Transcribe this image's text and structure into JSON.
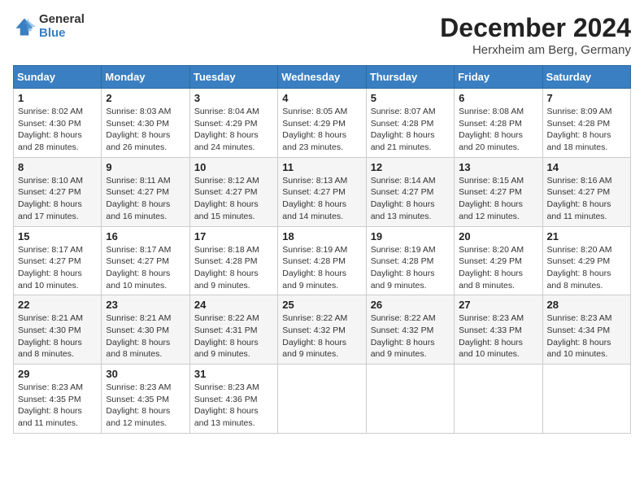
{
  "header": {
    "logo_line1": "General",
    "logo_line2": "Blue",
    "month": "December 2024",
    "location": "Herxheim am Berg, Germany"
  },
  "days_of_week": [
    "Sunday",
    "Monday",
    "Tuesday",
    "Wednesday",
    "Thursday",
    "Friday",
    "Saturday"
  ],
  "weeks": [
    [
      {
        "day": 1,
        "sunrise": "8:02 AM",
        "sunset": "4:30 PM",
        "daylight": "8 hours and 28 minutes."
      },
      {
        "day": 2,
        "sunrise": "8:03 AM",
        "sunset": "4:30 PM",
        "daylight": "8 hours and 26 minutes."
      },
      {
        "day": 3,
        "sunrise": "8:04 AM",
        "sunset": "4:29 PM",
        "daylight": "8 hours and 24 minutes."
      },
      {
        "day": 4,
        "sunrise": "8:05 AM",
        "sunset": "4:29 PM",
        "daylight": "8 hours and 23 minutes."
      },
      {
        "day": 5,
        "sunrise": "8:07 AM",
        "sunset": "4:28 PM",
        "daylight": "8 hours and 21 minutes."
      },
      {
        "day": 6,
        "sunrise": "8:08 AM",
        "sunset": "4:28 PM",
        "daylight": "8 hours and 20 minutes."
      },
      {
        "day": 7,
        "sunrise": "8:09 AM",
        "sunset": "4:28 PM",
        "daylight": "8 hours and 18 minutes."
      }
    ],
    [
      {
        "day": 8,
        "sunrise": "8:10 AM",
        "sunset": "4:27 PM",
        "daylight": "8 hours and 17 minutes."
      },
      {
        "day": 9,
        "sunrise": "8:11 AM",
        "sunset": "4:27 PM",
        "daylight": "8 hours and 16 minutes."
      },
      {
        "day": 10,
        "sunrise": "8:12 AM",
        "sunset": "4:27 PM",
        "daylight": "8 hours and 15 minutes."
      },
      {
        "day": 11,
        "sunrise": "8:13 AM",
        "sunset": "4:27 PM",
        "daylight": "8 hours and 14 minutes."
      },
      {
        "day": 12,
        "sunrise": "8:14 AM",
        "sunset": "4:27 PM",
        "daylight": "8 hours and 13 minutes."
      },
      {
        "day": 13,
        "sunrise": "8:15 AM",
        "sunset": "4:27 PM",
        "daylight": "8 hours and 12 minutes."
      },
      {
        "day": 14,
        "sunrise": "8:16 AM",
        "sunset": "4:27 PM",
        "daylight": "8 hours and 11 minutes."
      }
    ],
    [
      {
        "day": 15,
        "sunrise": "8:17 AM",
        "sunset": "4:27 PM",
        "daylight": "8 hours and 10 minutes."
      },
      {
        "day": 16,
        "sunrise": "8:17 AM",
        "sunset": "4:27 PM",
        "daylight": "8 hours and 10 minutes."
      },
      {
        "day": 17,
        "sunrise": "8:18 AM",
        "sunset": "4:28 PM",
        "daylight": "8 hours and 9 minutes."
      },
      {
        "day": 18,
        "sunrise": "8:19 AM",
        "sunset": "4:28 PM",
        "daylight": "8 hours and 9 minutes."
      },
      {
        "day": 19,
        "sunrise": "8:19 AM",
        "sunset": "4:28 PM",
        "daylight": "8 hours and 9 minutes."
      },
      {
        "day": 20,
        "sunrise": "8:20 AM",
        "sunset": "4:29 PM",
        "daylight": "8 hours and 8 minutes."
      },
      {
        "day": 21,
        "sunrise": "8:20 AM",
        "sunset": "4:29 PM",
        "daylight": "8 hours and 8 minutes."
      }
    ],
    [
      {
        "day": 22,
        "sunrise": "8:21 AM",
        "sunset": "4:30 PM",
        "daylight": "8 hours and 8 minutes."
      },
      {
        "day": 23,
        "sunrise": "8:21 AM",
        "sunset": "4:30 PM",
        "daylight": "8 hours and 8 minutes."
      },
      {
        "day": 24,
        "sunrise": "8:22 AM",
        "sunset": "4:31 PM",
        "daylight": "8 hours and 9 minutes."
      },
      {
        "day": 25,
        "sunrise": "8:22 AM",
        "sunset": "4:32 PM",
        "daylight": "8 hours and 9 minutes."
      },
      {
        "day": 26,
        "sunrise": "8:22 AM",
        "sunset": "4:32 PM",
        "daylight": "8 hours and 9 minutes."
      },
      {
        "day": 27,
        "sunrise": "8:23 AM",
        "sunset": "4:33 PM",
        "daylight": "8 hours and 10 minutes."
      },
      {
        "day": 28,
        "sunrise": "8:23 AM",
        "sunset": "4:34 PM",
        "daylight": "8 hours and 10 minutes."
      }
    ],
    [
      {
        "day": 29,
        "sunrise": "8:23 AM",
        "sunset": "4:35 PM",
        "daylight": "8 hours and 11 minutes."
      },
      {
        "day": 30,
        "sunrise": "8:23 AM",
        "sunset": "4:35 PM",
        "daylight": "8 hours and 12 minutes."
      },
      {
        "day": 31,
        "sunrise": "8:23 AM",
        "sunset": "4:36 PM",
        "daylight": "8 hours and 13 minutes."
      },
      null,
      null,
      null,
      null
    ]
  ]
}
